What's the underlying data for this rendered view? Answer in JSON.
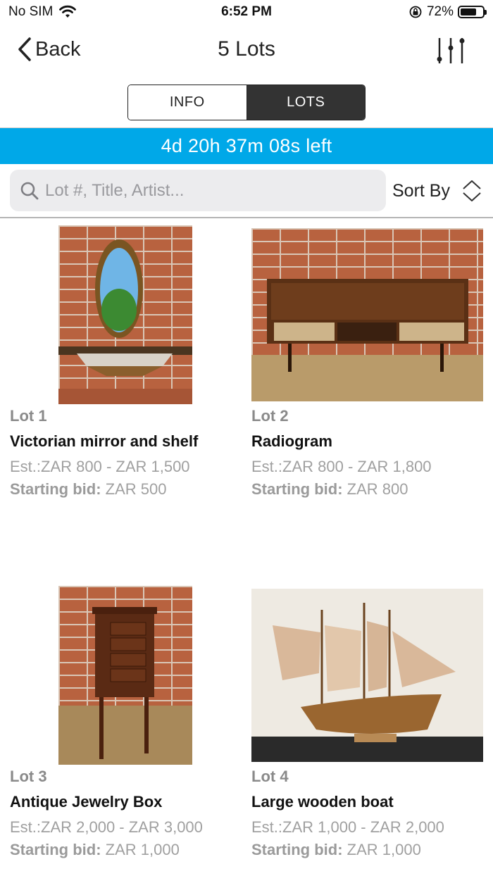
{
  "status_bar": {
    "carrier": "No SIM",
    "time": "6:52 PM",
    "battery_percent": "72%",
    "battery_level": 0.72
  },
  "nav": {
    "back_label": "Back",
    "title": "5 Lots"
  },
  "segments": {
    "info_label": "INFO",
    "lots_label": "LOTS",
    "selected": "LOTS"
  },
  "timer": {
    "text": "4d 20h 37m 08s left",
    "color": "#00a8e8"
  },
  "search": {
    "placeholder": "Lot #, Title, Artist...",
    "value": ""
  },
  "sort": {
    "label": "Sort By"
  },
  "lots": [
    {
      "number": "Lot 1",
      "title": "Victorian mirror and shelf",
      "estimate": "Est.:ZAR 800 - ZAR 1,500",
      "bid_label": "Starting bid:",
      "bid_value": "ZAR 500"
    },
    {
      "number": "Lot 2",
      "title": "Radiogram",
      "estimate": "Est.:ZAR 800 - ZAR 1,800",
      "bid_label": "Starting bid:",
      "bid_value": "ZAR 800"
    },
    {
      "number": "Lot 3",
      "title": "Antique Jewelry Box",
      "estimate": "Est.:ZAR 2,000 - ZAR 3,000",
      "bid_label": "Starting bid:",
      "bid_value": "ZAR 1,000"
    },
    {
      "number": "Lot 4",
      "title": "Large wooden boat",
      "estimate": "Est.:ZAR 1,000 - ZAR 2,000",
      "bid_label": "Starting bid:",
      "bid_value": "ZAR 1,000"
    }
  ]
}
